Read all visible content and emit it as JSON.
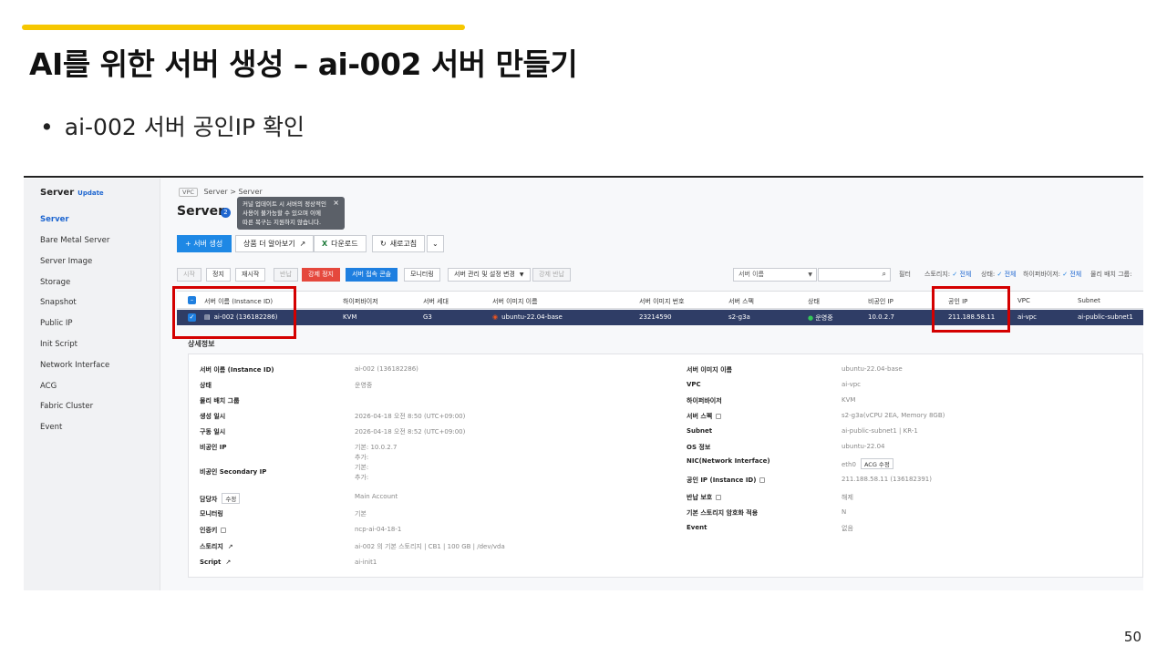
{
  "slide": {
    "title": "AI를 위한 서버 생성 – ai-002 서버 만들기",
    "bullet": "ai-002 서버 공인IP 확인",
    "page_number": "50",
    "accent_color": "#f6c700",
    "highlight_color": "#d40000"
  },
  "console": {
    "sidebar": {
      "title": "Server",
      "badge": "Update",
      "items": [
        "Server",
        "Bare Metal Server",
        "Server Image",
        "Storage",
        "Snapshot",
        "Public IP",
        "Init Script",
        "Network Interface",
        "ACG",
        "Fabric Cluster",
        "Event"
      ],
      "active_item": "Server"
    },
    "breadcrumb": {
      "vpc": "VPC",
      "path1": "Server",
      "sep": ">",
      "path2": "Server"
    },
    "page_title": "Server",
    "help_badge": "2",
    "tooltip": {
      "lines": [
        "커널 업데이트 시 서버의 정상적인",
        "사용이 불가능할 수 있으며 이에",
        "따른 복구는 지원하지 않습니다."
      ],
      "close": "×"
    },
    "toolbar": {
      "create": "+ 서버 생성",
      "learn_more": "상품 더 알아보기",
      "download": "다운로드",
      "refresh": "새로고침",
      "more": "⌄"
    },
    "actions": {
      "start": "시작",
      "stop": "정지",
      "restart": "재시작",
      "return": "반납",
      "force_stop": "강제 정지",
      "connect_console": "서버 접속 콘솔",
      "monitoring": "모니터링",
      "manage_settings": "서버 관리 및 설정 변경",
      "force_return": "강제 반납"
    },
    "filter": {
      "select_value": "서버 이름",
      "filter_label": "필터",
      "storage": "스토리지:",
      "storage_value": "전체",
      "status": "상태:",
      "status_value": "전체",
      "hypervisor": "하이퍼바이저:",
      "hypervisor_value": "전체",
      "placement": "물리 배치 그룹:"
    },
    "table": {
      "headers": [
        "서버 이름 (Instance ID)",
        "하이퍼바이저",
        "서버 세대",
        "서버 이미지 이름",
        "서버 이미지 번호",
        "서버 스펙",
        "상태",
        "비공인 IP",
        "공인 IP",
        "VPC",
        "Subnet"
      ],
      "row": {
        "name": "ai-002 (136182286)",
        "hypervisor": "KVM",
        "generation": "G3",
        "image_name": "ubuntu-22.04-base",
        "image_no": "23214590",
        "spec": "s2-g3a",
        "status": "운영중",
        "private_ip": "10.0.2.7",
        "public_ip": "211.188.58.11",
        "vpc": "ai-vpc",
        "subnet": "ai-public-subnet1"
      }
    },
    "detail": {
      "title": "상세정보",
      "left": [
        {
          "label": "서버 이름 (Instance ID)",
          "value": "ai-002 (136182286)"
        },
        {
          "label": "상태",
          "value": "운영중"
        },
        {
          "label": "물리 배치 그룹",
          "value": ""
        },
        {
          "label": "생성 일시",
          "value": "2026-04-18 오전 8:50 (UTC+09:00)"
        },
        {
          "label": "구동 일시",
          "value": "2026-04-18 오전 8:52 (UTC+09:00)"
        },
        {
          "label": "비공인 IP",
          "value": "기본: 10.0.2.7",
          "value2": "추가:"
        },
        {
          "label": "비공인 Secondary IP",
          "value": "기본:",
          "value2": "추가:"
        },
        {
          "label": "담당자",
          "button": "수정",
          "value": "Main Account"
        },
        {
          "label": "모니터링",
          "value": "기본"
        },
        {
          "label": "인증키",
          "value": "ncp-ai-04-18-1"
        },
        {
          "label": "스토리지",
          "value": "ai-002 의 기본 스토리지 | CB1 | 100 GB | /dev/vda"
        },
        {
          "label": "Script",
          "value": "ai-init1"
        }
      ],
      "right": [
        {
          "label": "서버 이미지 이름",
          "value": "ubuntu-22.04-base"
        },
        {
          "label": "VPC",
          "value": "ai-vpc"
        },
        {
          "label": "하이퍼바이저",
          "value": "KVM"
        },
        {
          "label": "서버 스펙",
          "value": "s2-g3a(vCPU 2EA, Memory 8GB)"
        },
        {
          "label": "Subnet",
          "value": "ai-public-subnet1 | KR-1"
        },
        {
          "label": "OS 정보",
          "value": "ubuntu-22.04"
        },
        {
          "label": "NIC(Network Interface)",
          "value": "eth0",
          "button": "ACG 수정"
        },
        {
          "label": "공인 IP (Instance ID)",
          "value": "211.188.58.11 (136182391)"
        },
        {
          "label": "반납 보호",
          "value": "해제"
        },
        {
          "label": "기본 스토리지 암호화 적용",
          "value": "N"
        },
        {
          "label": "Event",
          "value": "없음"
        }
      ]
    }
  }
}
